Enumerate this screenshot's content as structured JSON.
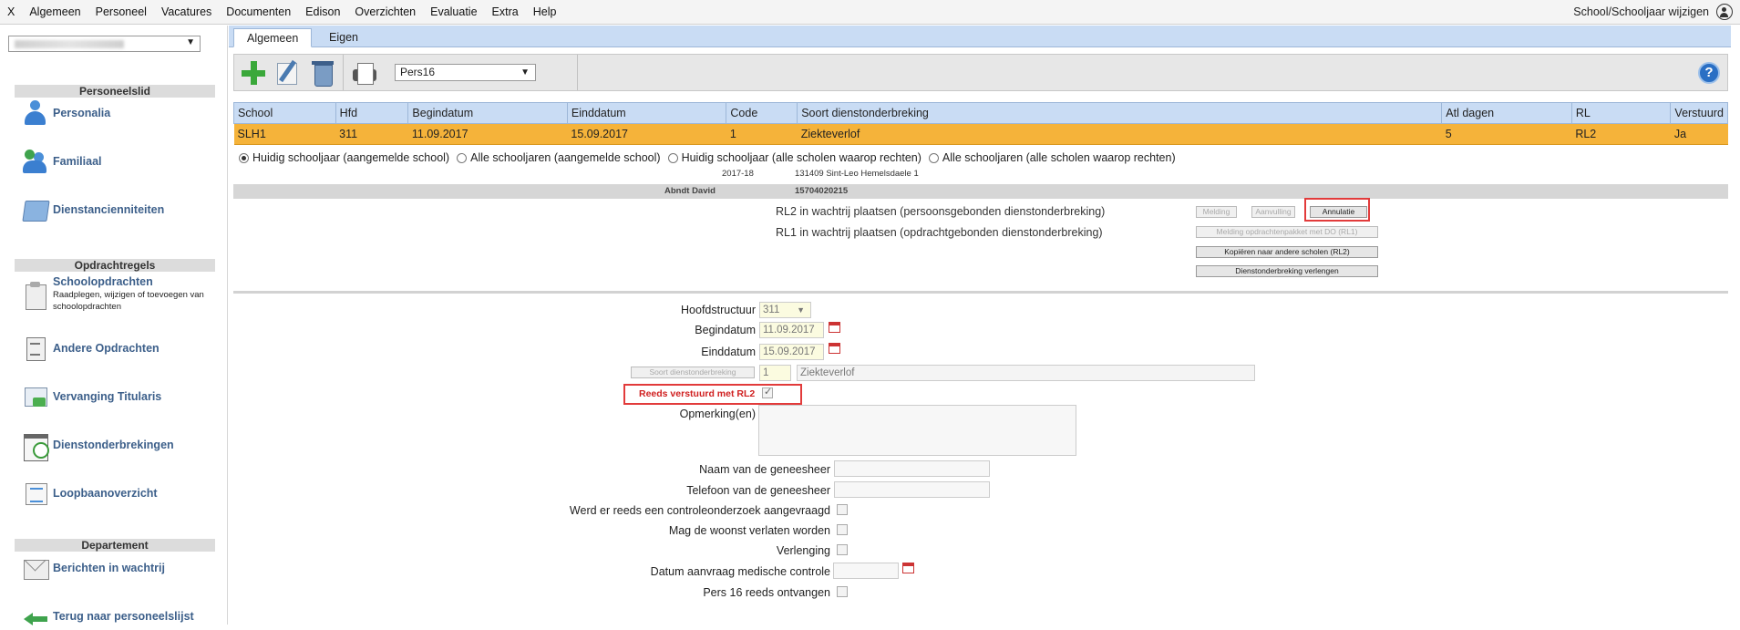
{
  "menu": {
    "items": [
      "X",
      "Algemeen",
      "Personeel",
      "Vacatures",
      "Documenten",
      "Edison",
      "Overzichten",
      "Evaluatie",
      "Extra",
      "Help"
    ],
    "right_label": "School/Schooljaar wijzigen"
  },
  "sidebar": {
    "section1": "Personeelslid",
    "personalia": "Personalia",
    "familiaal": "Familiaal",
    "dienstancienniteiten": "Dienstancienniteiten",
    "section2": "Opdrachtregels",
    "schoolopdrachten": "Schoolopdrachten",
    "schoolopdrachten_sub": "Raadplegen, wijzigen of toevoegen van schoolopdrachten",
    "andere_opdrachten": "Andere Opdrachten",
    "vervanging": "Vervanging Titularis",
    "dienstonderbrekingen": "Dienstonderbrekingen",
    "loopbaanoverzicht": "Loopbaanoverzicht",
    "section3": "Departement",
    "berichten": "Berichten in wachtrij",
    "terug": "Terug naar personeelslijst"
  },
  "tabs": {
    "algemeen": "Algemeen",
    "eigen": "Eigen"
  },
  "toolbar": {
    "report_select": "Pers16",
    "help": "?"
  },
  "table": {
    "headers": [
      "School",
      "Hfd",
      "Begindatum",
      "Einddatum",
      "Code",
      "Soort dienstonderbreking",
      "Atl dagen",
      "RL",
      "Verstuurd"
    ],
    "row": [
      "SLH1",
      "311",
      "11.09.2017",
      "15.09.2017",
      "1",
      "Ziekteverlof",
      "5",
      "RL2",
      "Ja"
    ]
  },
  "filters": {
    "r1": "Huidig schooljaar (aangemelde school)",
    "r2": "Alle schooljaren (aangemelde school)",
    "r3": "Huidig schooljaar (alle scholen waarop rechten)",
    "r4": "Alle schooljaren (alle scholen waarop rechten)"
  },
  "info": {
    "year": "2017-18",
    "school": "131409 Sint-Leo Hemelsdaele 1",
    "name": "Abndt David",
    "number": "15704020215"
  },
  "actions": {
    "rl2_label": "RL2 in wachtrij plaatsen (persoonsgebonden dienstonderbreking)",
    "rl1_label": "RL1 in wachtrij plaatsen (opdrachtgebonden dienstonderbreking)",
    "melding": "Melding",
    "aanvulling": "Aanvulling",
    "annulatie": "Annulatie",
    "melding_rl1": "Melding opdrachtenpakket met DO (RL1)",
    "kopieren": "Kopiëren naar andere scholen (RL2)",
    "verlengen": "Dienstonderbreking verlengen"
  },
  "form": {
    "hoofdstructuur_label": "Hoofdstructuur",
    "hoofdstructuur_value": "311",
    "begindatum_label": "Begindatum",
    "begindatum_value": "11.09.2017",
    "einddatum_label": "Einddatum",
    "einddatum_value": "15.09.2017",
    "soort_button": "Soort dienstonderbreking",
    "soort_code": "1",
    "soort_text": "Ziekteverlof",
    "reeds_verstuurd_label": "Reeds verstuurd met RL2",
    "opmerking_label": "Opmerking(en)",
    "naam_geneesheer_label": "Naam van de geneesheer",
    "telefoon_geneesheer_label": "Telefoon van de geneesheer",
    "controleonderzoek_label": "Werd er reeds een controleonderzoek aangevraagd",
    "woonst_label": "Mag de woonst verlaten worden",
    "verlenging_label": "Verlenging",
    "datum_controle_label": "Datum aanvraag medische controle",
    "pers16_label": "Pers 16 reeds ontvangen"
  },
  "colors": {
    "accent": "#c9dcf4",
    "selected_row": "#f5b33a",
    "highlight": "#e23b3b"
  }
}
